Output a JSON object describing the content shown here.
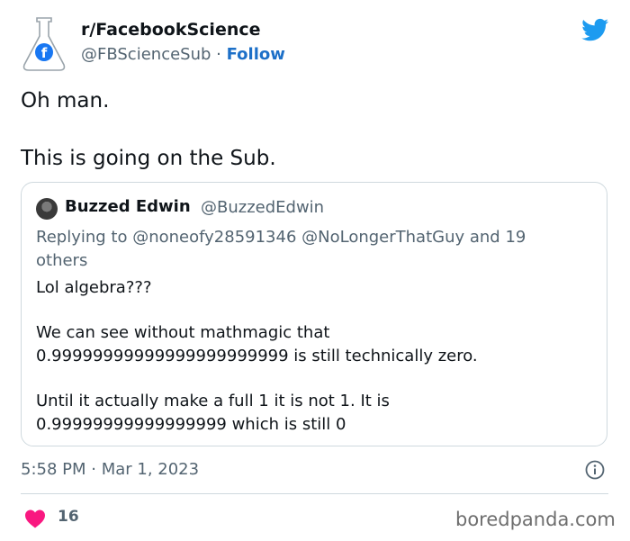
{
  "header": {
    "account_name": "r/FacebookScience",
    "handle": "@FBScienceSub",
    "separator": " · ",
    "follow_label": "Follow"
  },
  "tweet": {
    "line1": "Oh man.",
    "line2": "This is going on the Sub."
  },
  "quote": {
    "name": "Buzzed Edwin",
    "handle": "@BuzzedEdwin",
    "reply_line1": "Replying to @noneofy28591346 @NoLongerThatGuy and 19",
    "reply_line2": "others",
    "para1": "Lol algebra???",
    "para2_line1": "We can see without mathmagic that",
    "para2_line2": "0.99999999999999999999999 is still technically zero.",
    "para3_line1": "Until it actually make a full 1 it is not 1. It is",
    "para3_line2": "0.99999999999999999 which is still 0"
  },
  "meta": {
    "timestamp": "5:58 PM · Mar 1, 2023"
  },
  "actions": {
    "likes": "16"
  },
  "watermark": "boredpanda.com",
  "colors": {
    "twitter_blue": "#1d9bf0",
    "follow_blue": "#1d70c8",
    "heart_red": "#f91880",
    "secondary_text": "#536471"
  }
}
